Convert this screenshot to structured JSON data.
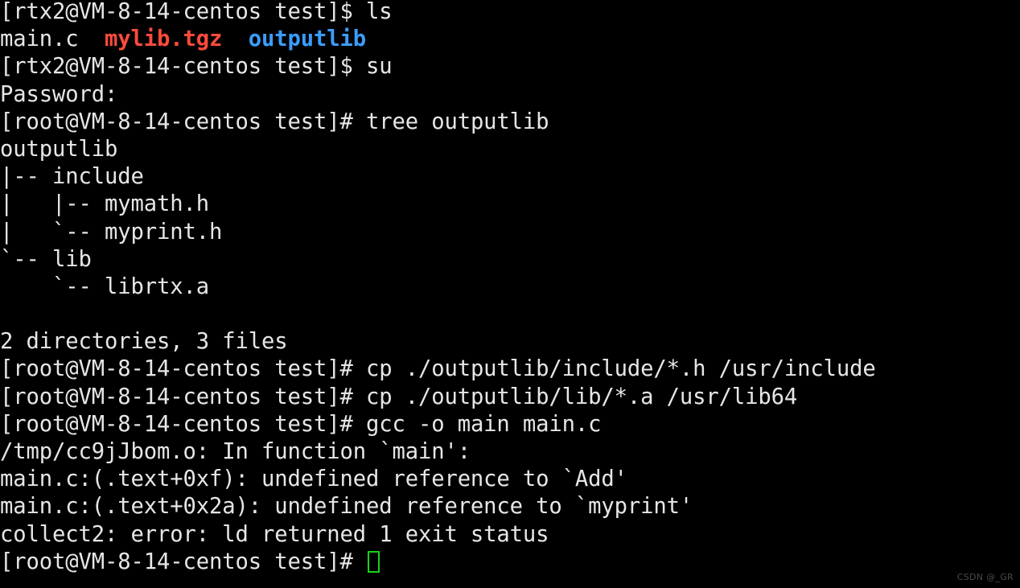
{
  "terminal": {
    "background_color": "#000000",
    "foreground_color": "#e6e6e6",
    "dir_color": "#3b9dfc",
    "archive_color": "#fc4b3c",
    "cursor_color": "#17d417",
    "prompt_user": "[rtx2@VM-8-14-centos test]$ ",
    "prompt_root": "[root@VM-8-14-centos test]# ",
    "lines": [
      {
        "id": "line-01-prompt-ls",
        "kind": "command",
        "segments": [
          {
            "text": "[rtx2@VM-8-14-centos test]$ ",
            "color": "default"
          },
          {
            "text": "ls",
            "color": "default"
          }
        ]
      },
      {
        "id": "line-02-ls-output",
        "kind": "output",
        "segments": [
          {
            "text": "main.c  ",
            "color": "default"
          },
          {
            "text": "mylib.tgz",
            "color": "red"
          },
          {
            "text": "  ",
            "color": "default"
          },
          {
            "text": "outputlib",
            "color": "blue"
          }
        ]
      },
      {
        "id": "line-03-prompt-su",
        "kind": "command",
        "segments": [
          {
            "text": "[rtx2@VM-8-14-centos test]$ ",
            "color": "default"
          },
          {
            "text": "su",
            "color": "default"
          }
        ]
      },
      {
        "id": "line-04-password",
        "kind": "output",
        "segments": [
          {
            "text": "Password:",
            "color": "default"
          }
        ]
      },
      {
        "id": "line-05-prompt-tree",
        "kind": "command",
        "segments": [
          {
            "text": "[root@VM-8-14-centos test]# ",
            "color": "default"
          },
          {
            "text": "tree outputlib",
            "color": "default"
          }
        ]
      },
      {
        "id": "line-06-tree-root",
        "kind": "output",
        "segments": [
          {
            "text": "outputlib",
            "color": "default"
          }
        ]
      },
      {
        "id": "line-07-tree-include",
        "kind": "output",
        "segments": [
          {
            "text": "|-- include",
            "color": "default"
          }
        ]
      },
      {
        "id": "line-08-tree-mymath",
        "kind": "output",
        "segments": [
          {
            "text": "|   |-- mymath.h",
            "color": "default"
          }
        ]
      },
      {
        "id": "line-09-tree-myprint",
        "kind": "output",
        "segments": [
          {
            "text": "|   `-- myprint.h",
            "color": "default"
          }
        ]
      },
      {
        "id": "line-10-tree-lib",
        "kind": "output",
        "segments": [
          {
            "text": "`-- lib",
            "color": "default"
          }
        ]
      },
      {
        "id": "line-11-tree-librtx",
        "kind": "output",
        "segments": [
          {
            "text": "    `-- librtx.a",
            "color": "default"
          }
        ]
      },
      {
        "id": "line-12-blank",
        "kind": "blank",
        "segments": [
          {
            "text": " ",
            "color": "default"
          }
        ]
      },
      {
        "id": "line-13-tree-summary",
        "kind": "output",
        "segments": [
          {
            "text": "2 directories, 3 files",
            "color": "default"
          }
        ]
      },
      {
        "id": "line-14-prompt-cp-include",
        "kind": "command",
        "segments": [
          {
            "text": "[root@VM-8-14-centos test]# ",
            "color": "default"
          },
          {
            "text": "cp ./outputlib/include/*.h /usr/include",
            "color": "default"
          }
        ]
      },
      {
        "id": "line-15-prompt-cp-lib",
        "kind": "command",
        "segments": [
          {
            "text": "[root@VM-8-14-centos test]# ",
            "color": "default"
          },
          {
            "text": "cp ./outputlib/lib/*.a /usr/lib64",
            "color": "default"
          }
        ]
      },
      {
        "id": "line-16-prompt-gcc",
        "kind": "command",
        "segments": [
          {
            "text": "[root@VM-8-14-centos test]# ",
            "color": "default"
          },
          {
            "text": "gcc -o main main.c",
            "color": "default"
          }
        ]
      },
      {
        "id": "line-17-err-infunction",
        "kind": "output",
        "segments": [
          {
            "text": "/tmp/cc9jJbom.o: In function `main':",
            "color": "default"
          }
        ]
      },
      {
        "id": "line-18-err-undefined-add",
        "kind": "output",
        "segments": [
          {
            "text": "main.c:(.text+0xf): undefined reference to `Add'",
            "color": "default"
          }
        ]
      },
      {
        "id": "line-19-err-undefined-myprint",
        "kind": "output",
        "segments": [
          {
            "text": "main.c:(.text+0x2a): undefined reference to `myprint'",
            "color": "default"
          }
        ]
      },
      {
        "id": "line-20-err-collect2",
        "kind": "output",
        "segments": [
          {
            "text": "collect2: error: ld returned 1 exit status",
            "color": "default"
          }
        ]
      },
      {
        "id": "line-21-prompt-cursor",
        "kind": "prompt-cursor",
        "segments": [
          {
            "text": "[root@VM-8-14-centos test]# ",
            "color": "default"
          }
        ]
      }
    ]
  },
  "watermark": {
    "text": "CSDN @_GR"
  }
}
